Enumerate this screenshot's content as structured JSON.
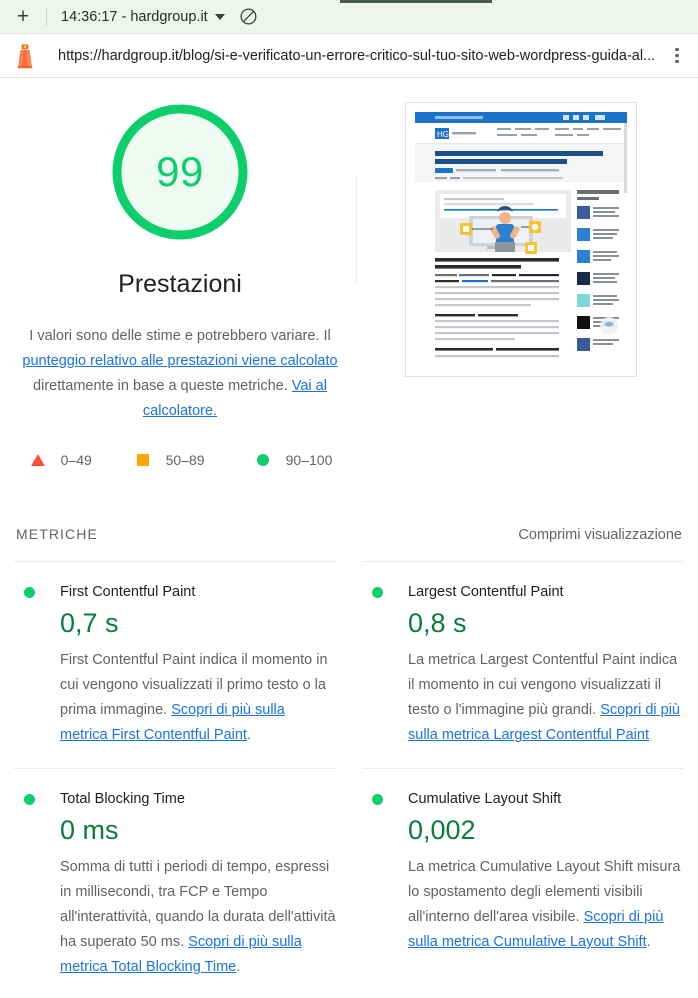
{
  "browser": {
    "new_tab_label": "+",
    "tab_title": "14:36:17 - hardgroup.it",
    "block_icon": "block-icon",
    "url": "https://hardgroup.it/blog/si-e-verificato-un-errore-critico-sul-tuo-sito-web-wordpress-guida-al...",
    "menu_icon": "kebab-menu-icon",
    "site_icon": "lighthouse-icon"
  },
  "gauge": {
    "score": "99",
    "label": "Prestazioni",
    "ring_color": "#0cce6b",
    "fill_color": "#eefbf3",
    "score_color": "#0cce6b",
    "percent": 99
  },
  "estimate": {
    "line1": "I valori sono delle stime e potrebbero variare. Il ",
    "link1": "punteggio relativo alle prestazioni viene calcolato",
    "line2": " direttamente in base a queste metriche. ",
    "link2": "Vai al calcolatore."
  },
  "legend": [
    {
      "shape": "triangle",
      "color": "#ff4e42",
      "range": "0–49"
    },
    {
      "shape": "square",
      "color": "#ffa400",
      "range": "50–89"
    },
    {
      "shape": "circle",
      "color": "#0cce6b",
      "range": "90–100"
    }
  ],
  "thumbnail": {
    "alt": "page-screenshot-thumbnail",
    "page_title": "Si è verificato un errore critico sul tuo sito web WordPress. Guida alla soluzione dell'errore.",
    "heading2": "Cosa significa \"Si è verificato un errore critico sul tuo sito web WordPress\"?",
    "sidebar_title": "Potrebbe interessarti anche",
    "brand": "HG"
  },
  "metrics_section": {
    "title": "METRICHE",
    "collapse_label": "Comprimi visualizzazione"
  },
  "metrics": [
    {
      "name": "First Contentful Paint",
      "value": "0,7 s",
      "status_color": "#0cce6b",
      "desc_before": "First Contentful Paint indica il momento in cui vengono visualizzati il primo testo o la prima immagine. ",
      "desc_link": "Scopri di più sulla metrica First Contentful Paint",
      "desc_after": "."
    },
    {
      "name": "Largest Contentful Paint",
      "value": "0,8 s",
      "status_color": "#0cce6b",
      "desc_before": "La metrica Largest Contentful Paint indica il momento in cui vengono visualizzati il testo o l'immagine più grandi. ",
      "desc_link": "Scopri di più sulla metrica Largest Contentful Paint",
      "desc_after": ""
    },
    {
      "name": "Total Blocking Time",
      "value": "0 ms",
      "status_color": "#0cce6b",
      "desc_before": "Somma di tutti i periodi di tempo, espressi in millisecondi, tra FCP e Tempo all'interattività, quando la durata dell'attività ha superato 50 ms. ",
      "desc_link": "Scopri di più sulla metrica Total Blocking Time",
      "desc_after": "."
    },
    {
      "name": "Cumulative Layout Shift",
      "value": "0,002",
      "status_color": "#0cce6b",
      "desc_before": "La metrica Cumulative Layout Shift misura lo spostamento degli elementi visibili all'interno dell'area visibile. ",
      "desc_link": "Scopri di più sulla metrica Cumulative Layout Shift",
      "desc_after": "."
    }
  ]
}
